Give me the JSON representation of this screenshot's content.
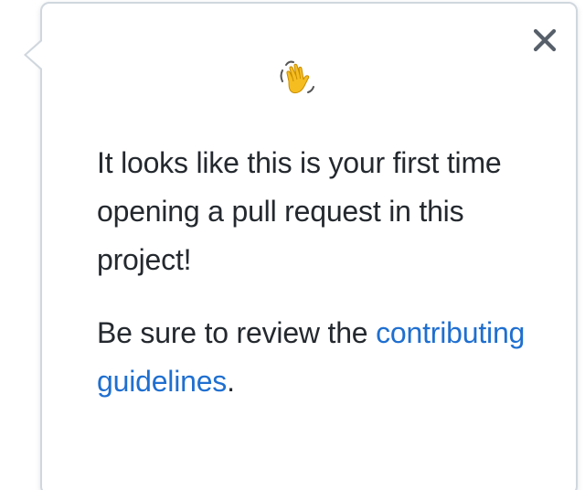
{
  "popover": {
    "wave_emoji": "👋",
    "message_line": "It looks like this is your first time opening a pull request in this project!",
    "review_prefix": "Be sure to review the",
    "link_text": "contributing guidelines",
    "review_suffix": ".",
    "close_icon": "close-icon",
    "colors": {
      "text": "#24292f",
      "link": "#1f6fd0",
      "border": "#d0d7de",
      "close": "#57606a"
    }
  }
}
